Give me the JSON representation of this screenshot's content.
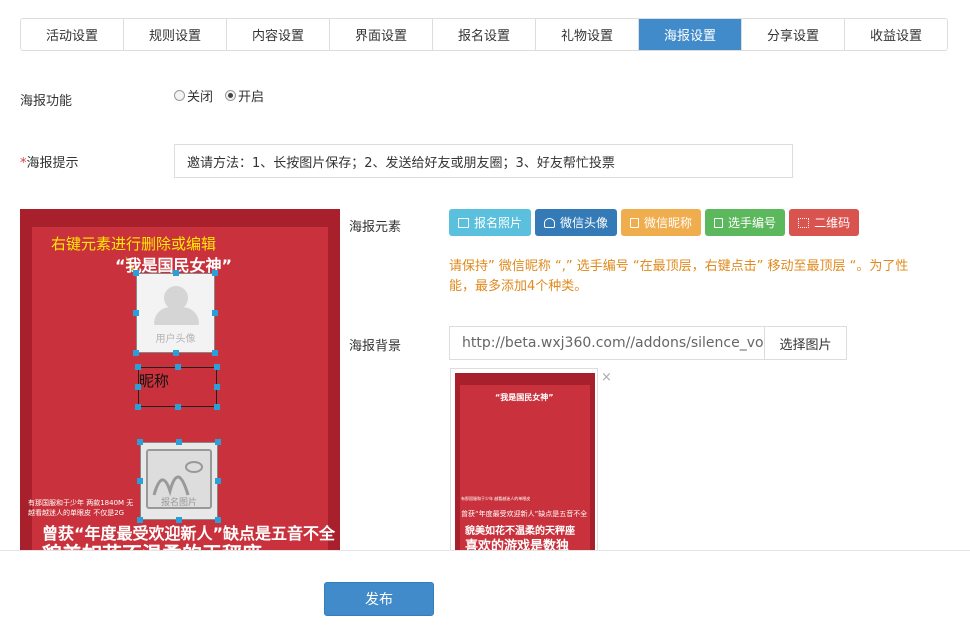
{
  "tabs": [
    {
      "label": "活动设置",
      "active": false
    },
    {
      "label": "规则设置",
      "active": false
    },
    {
      "label": "内容设置",
      "active": false
    },
    {
      "label": "界面设置",
      "active": false
    },
    {
      "label": "报名设置",
      "active": false
    },
    {
      "label": "礼物设置",
      "active": false
    },
    {
      "label": "海报设置",
      "active": true
    },
    {
      "label": "分享设置",
      "active": false
    },
    {
      "label": "收益设置",
      "active": false
    }
  ],
  "poster_function": {
    "label": "海报功能",
    "options": [
      {
        "label": "关闭",
        "checked": false
      },
      {
        "label": "开启",
        "checked": true
      }
    ]
  },
  "poster_hint": {
    "required_mark": "*",
    "label": "海报提示",
    "value": "邀请方法：1、长按图片保存；2、发送给好友或朋友圈；3、好友帮忙投票"
  },
  "poster_editor": {
    "tip": "右键元素进行删除或编辑",
    "title": "“我是国民女神”",
    "avatar_caption": "用户头像",
    "nickname": "昵称",
    "photo_caption": "报名图片",
    "text_line1": "有那国服和于少年 两款1840M 无",
    "text_line2": "越看越迷人的单眼皮  不仅是2G",
    "text_line3": "曾获“年度最受欢迎新人”缺点是五音不全",
    "text_line4": "貌美如花不温柔的天秤座"
  },
  "poster_elements": {
    "label": "海报元素",
    "buttons": [
      {
        "label": "报名照片",
        "icon": "image-icon",
        "color": "#5bc0de"
      },
      {
        "label": "微信头像",
        "icon": "user-icon",
        "color": "#337ab7"
      },
      {
        "label": "微信昵称",
        "icon": "file-icon",
        "color": "#f0ad4e"
      },
      {
        "label": "选手编号",
        "icon": "file-icon",
        "color": "#5cb85c"
      },
      {
        "label": "二维码",
        "icon": "qrcode-icon",
        "color": "#d9534f"
      }
    ],
    "note": "请保持” 微信昵称 “,” 选手编号 “在最顶层，右键点击” 移动至最顶层 “。为了性能，最多添加4个种类。"
  },
  "poster_background": {
    "label": "海报背景",
    "url": "http://beta.wxj360.com//addons/silence_vo",
    "pick_label": "选择图片",
    "thumb_title": "“我是国民女神”",
    "thumb_line1": "有那国服和于少年 越看越迷人的单眼皮",
    "thumb_line2": "曾获“年度最受欢迎新人”缺点是五音不全",
    "thumb_line3": "貌美如花不温柔的天秤座",
    "thumb_line4": "喜欢的游戏是数独",
    "close_label": "×"
  },
  "footer": {
    "publish_label": "发布"
  }
}
